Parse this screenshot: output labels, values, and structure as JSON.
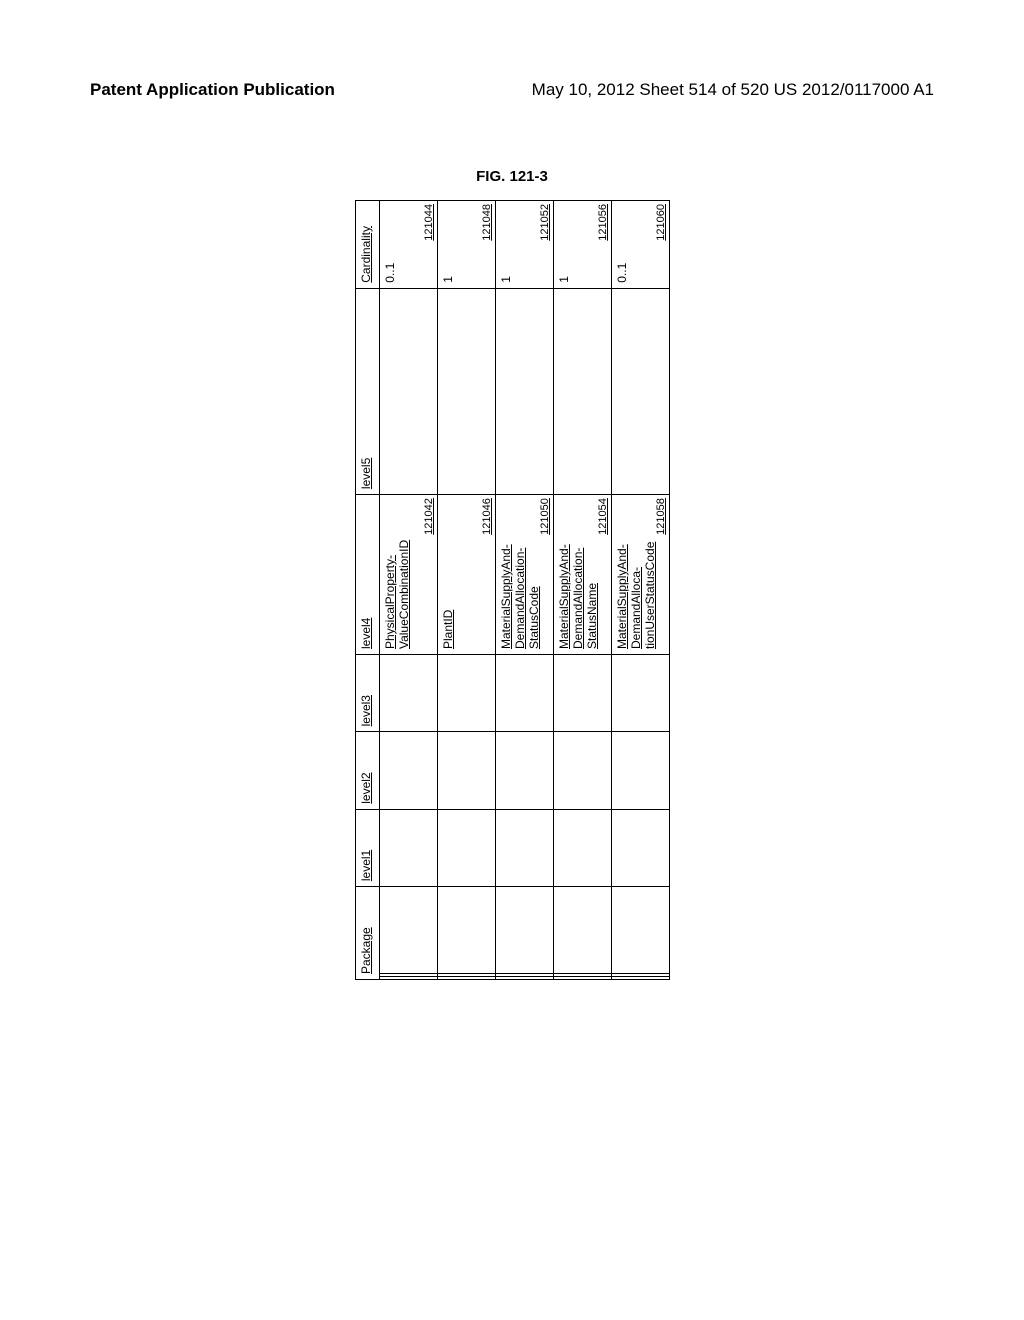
{
  "header": {
    "left": "Patent Application Publication",
    "right": "May 10, 2012  Sheet 514 of 520    US 2012/0117000 A1"
  },
  "figure_title": "FIG. 121-3",
  "headers": {
    "package": "Package",
    "level1": "level1",
    "level2": "level2",
    "level3": "level3",
    "level4": "level4",
    "level5": "level5",
    "cardinality": "Cardinality"
  },
  "rows": [
    {
      "level4": "PhysicalProperty-ValueCombinationID",
      "ref4": "121042",
      "cardinality": "0..1",
      "refc": "121044"
    },
    {
      "level4": "PlantID",
      "ref4": "121046",
      "cardinality": "1",
      "refc": "121048"
    },
    {
      "level4": "MaterialSupplyAnd-DemandAllocation-StatusCode",
      "ref4": "121050",
      "cardinality": "1",
      "refc": "121052"
    },
    {
      "level4": "MaterialSupplyAnd-DemandAllocation-StatusName",
      "ref4": "121054",
      "cardinality": "1",
      "refc": "121056"
    },
    {
      "level4": "MaterialSupplyAnd-DemandAlloca-tionUserStatusCode",
      "ref4": "121058",
      "cardinality": "0..1",
      "refc": "121060"
    }
  ]
}
